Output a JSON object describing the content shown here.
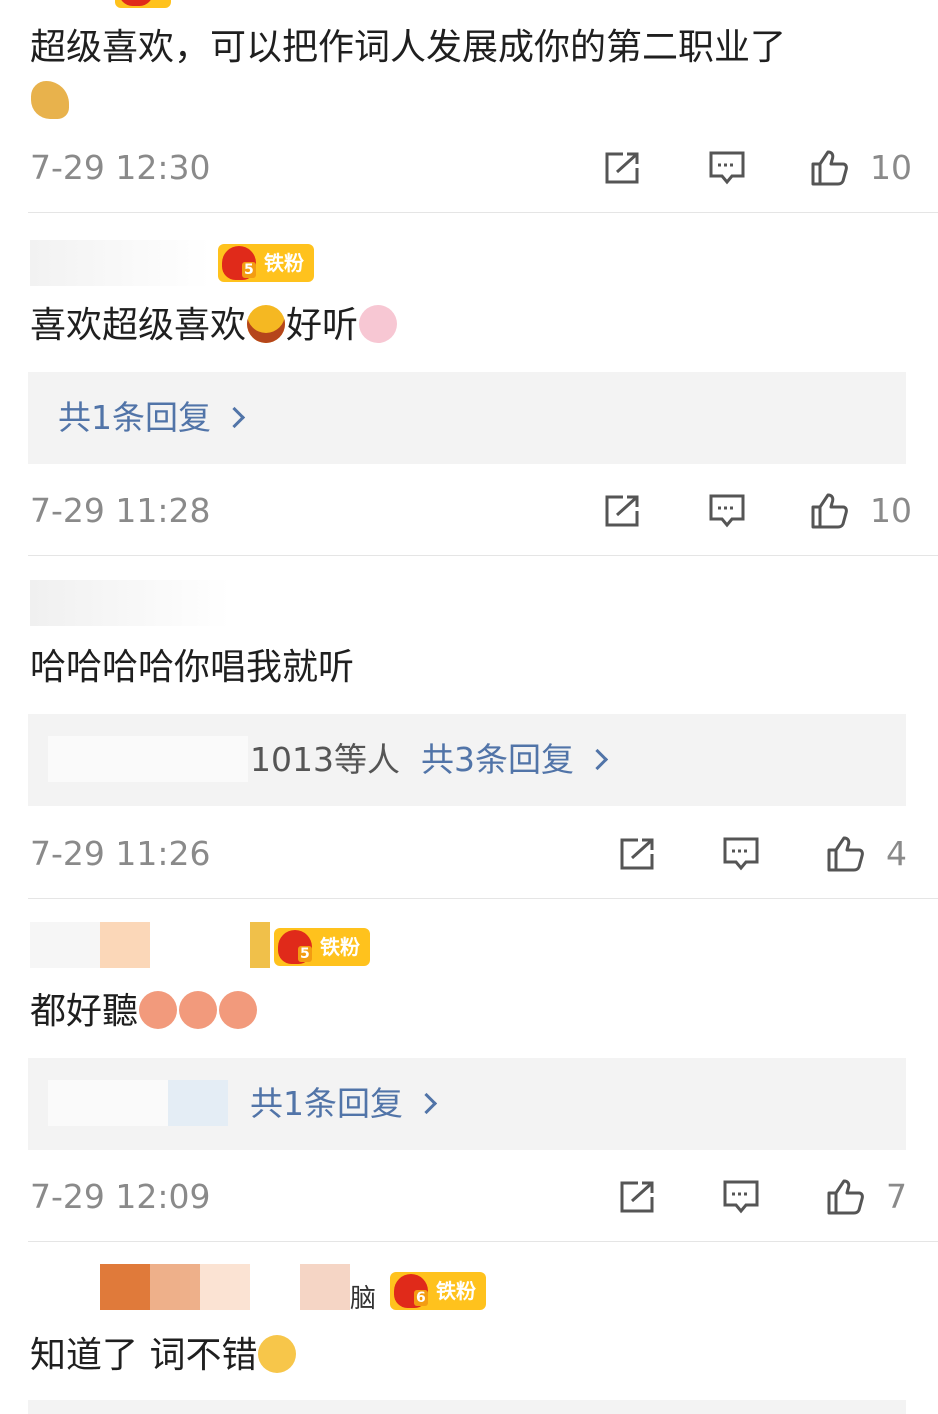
{
  "badge_label": "铁粉",
  "colors": {
    "link": "#5174a8",
    "badge": "#ffc21d",
    "crown": "#e02a1a",
    "meta": "#8a8a8a"
  },
  "comments": [
    {
      "text": "超级喜欢，可以把作词人发展成你的第二职业了",
      "emojis": [
        "flexed-biceps"
      ],
      "time": "7-29 12:30",
      "likes": "10"
    },
    {
      "badge_level": "5",
      "text": "喜欢超级喜欢",
      "text_after": "好听",
      "emojis": [
        "grinning-face",
        "pink-bunny"
      ],
      "reply": "共1条回复",
      "time": "7-29 11:28",
      "likes": "10"
    },
    {
      "text": "哈哈哈哈你唱我就听",
      "reply_prefix": "1013等人",
      "reply": "共3条回复",
      "time": "7-29 11:26",
      "likes": "4"
    },
    {
      "badge_level": "5",
      "text": "都好聽",
      "emojis": [
        "doge-pink",
        "doge-pink",
        "doge-pink"
      ],
      "reply": "共1条回复",
      "time": "7-29 12:09",
      "likes": "7"
    },
    {
      "name_fragment": "脑",
      "badge_level": "6",
      "text": "知道了 词不错",
      "emojis": [
        "yummy-face"
      ]
    }
  ]
}
